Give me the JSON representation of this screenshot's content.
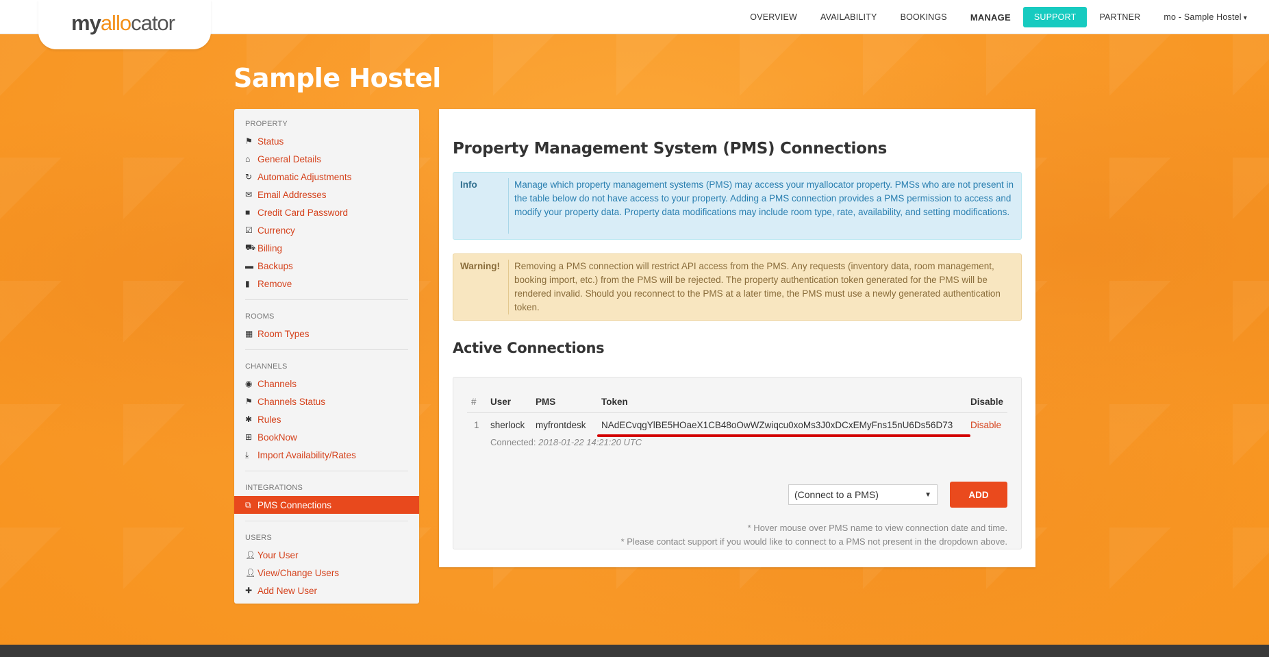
{
  "brand": {
    "logo_my": "my",
    "logo_alloc": "allo",
    "logo_rest": "cator"
  },
  "nav": {
    "items": [
      "OVERVIEW",
      "AVAILABILITY",
      "BOOKINGS"
    ],
    "manage": "MANAGE",
    "support": "SUPPORT",
    "partner": "PARTNER",
    "user": "mo - Sample Hostel"
  },
  "page_title": "Sample Hostel",
  "sidebar": {
    "property": {
      "heading": "PROPERTY",
      "items": [
        {
          "label": "Status",
          "icon": "flag-icon"
        },
        {
          "label": "General Details",
          "icon": "home-icon"
        },
        {
          "label": "Automatic Adjustments",
          "icon": "refresh-icon"
        },
        {
          "label": "Email Addresses",
          "icon": "envelope-icon"
        },
        {
          "label": "Credit Card Password",
          "icon": "lock-icon"
        },
        {
          "label": "Currency",
          "icon": "edit-icon"
        },
        {
          "label": "Billing",
          "icon": "cart-icon"
        },
        {
          "label": "Backups",
          "icon": "hdd-icon"
        },
        {
          "label": "Remove",
          "icon": "trash-icon"
        }
      ]
    },
    "rooms": {
      "heading": "ROOMS",
      "items": [
        {
          "label": "Room Types",
          "icon": "grid-icon"
        }
      ]
    },
    "channels": {
      "heading": "CHANNELS",
      "items": [
        {
          "label": "Channels",
          "icon": "globe-icon"
        },
        {
          "label": "Channels Status",
          "icon": "flag-icon"
        },
        {
          "label": "Rules",
          "icon": "asterisk-icon"
        },
        {
          "label": "BookNow",
          "icon": "widgets-icon"
        },
        {
          "label": "Import Availability/Rates",
          "icon": "download-icon"
        }
      ]
    },
    "integrations": {
      "heading": "INTEGRATIONS",
      "items": [
        {
          "label": "PMS Connections",
          "icon": "external-link-icon"
        }
      ]
    },
    "users": {
      "heading": "USERS",
      "items": [
        {
          "label": "Your User",
          "icon": "user-icon"
        },
        {
          "label": "View/Change Users",
          "icon": "user-icon"
        },
        {
          "label": "Add New User",
          "icon": "plus-icon"
        }
      ]
    }
  },
  "main": {
    "title": "Property Management System (PMS) Connections",
    "info": {
      "label": "Info",
      "text": "Manage which property management systems (PMS) may access your myallocator property. PMSs who are not present in the table below do not have access to your property. Adding a PMS connection provides a PMS permission to access and modify your property data. Property data modifications may include room type, rate, availability, and setting modifications."
    },
    "warning": {
      "label": "Warning!",
      "text": "Removing a PMS connection will restrict API access from the PMS. Any requests (inventory data, room management, booking import, etc.) from the PMS will be rejected. The property authentication token generated for the PMS will be rendered invalid. Should you reconnect to the PMS at a later time, the PMS must use a newly generated authentication token."
    },
    "active_title": "Active Connections",
    "table": {
      "headers": {
        "num": "#",
        "user": "User",
        "pms": "PMS",
        "token": "Token",
        "disable": "Disable"
      },
      "rows": [
        {
          "num": "1",
          "user": "sherlock",
          "pms": "myfrontdesk",
          "token": "NAdECvqgYlBE5HOaeX1CB48oOwWZwiqcu0xoMs3J0xDCxEMyFns15nU6Ds56D73",
          "disable": "Disable",
          "connected_label": "Connected:",
          "connected_value": "2018-01-22 14:21:20 UTC"
        }
      ]
    },
    "select": {
      "value": "(Connect to a PMS)"
    },
    "add_button": "ADD",
    "note1": "* Hover mouse over PMS name to view connection date and time.",
    "note2": "* Please contact support if you would like to connect to a PMS not present in the dropdown above."
  },
  "colors": {
    "accent": "#e8491d",
    "support": "#17cbc0",
    "background": "#f99a2a"
  }
}
